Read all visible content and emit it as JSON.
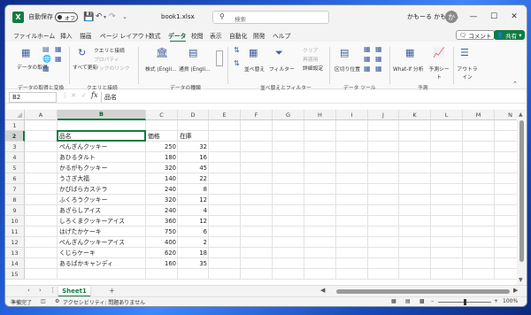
{
  "app": {
    "autosave_label": "自動保存",
    "autosave_state": "オフ",
    "filename": "book1.xlsx",
    "search_placeholder": "検索",
    "user_name": "かもーる かもかも",
    "avatar_initial": "か"
  },
  "menu": {
    "tabs": [
      "ファイル",
      "ホーム",
      "挿入",
      "描画",
      "ページ レイアウト",
      "数式",
      "データ",
      "校閲",
      "表示",
      "自動化",
      "開発",
      "ヘルプ"
    ],
    "active_tab": "データ",
    "comment_label": "コメント",
    "share_label": "共有"
  },
  "ribbon": {
    "get_data_label": "データの取得",
    "from_all_label": "すべて更新",
    "query_label": "クエリと接続",
    "property_label": "プロパティ",
    "link_label": "ブックのリンク",
    "stocks_label": "株式 (Engli…",
    "currency_label": "通貨 (Engli…",
    "sort_label": "並べ替え",
    "filter_label": "フィルター",
    "clear_label": "クリア",
    "reapply_label": "再適用",
    "advanced_label": "詳細設定",
    "text_to_cols_label": "区切り位置",
    "whatif_label": "What-If 分析",
    "forecast_label": "予測シート",
    "outline_label": "アウトライン",
    "groups": {
      "get_transform": "データの取得と変換",
      "queries": "クエリと接続",
      "data_types": "データの種類",
      "sort_filter": "並べ替えとフィルター",
      "data_tools": "データ ツール",
      "forecast": "予測"
    }
  },
  "formula_bar": {
    "name_box": "B2",
    "fx": "fx",
    "content": "品名"
  },
  "sheet": {
    "columns": [
      "A",
      "B",
      "C",
      "D",
      "E",
      "F",
      "G",
      "H",
      "I",
      "J",
      "K",
      "L",
      "M",
      "N"
    ],
    "rows": [
      "1",
      "2",
      "3",
      "4",
      "5",
      "6",
      "7",
      "8",
      "9",
      "10",
      "11",
      "12",
      "13",
      "14",
      "15"
    ],
    "headers": [
      "品名",
      "価格",
      "在庫"
    ],
    "data": [
      [
        "ぺんぎんクッキー",
        "250",
        "32"
      ],
      [
        "あひるタルト",
        "180",
        "16"
      ],
      [
        "かるがもクッキー",
        "320",
        "45"
      ],
      [
        "うさぎ大福",
        "140",
        "22"
      ],
      [
        "かぴばらカステラ",
        "240",
        "8"
      ],
      [
        "ふくろうクッキー",
        "320",
        "12"
      ],
      [
        "あざらしアイス",
        "240",
        "4"
      ],
      [
        "しろくまクッキーアイス",
        "360",
        "12"
      ],
      [
        "はげたかケーキ",
        "750",
        "6"
      ],
      [
        "ぺんぎんクッキーアイス",
        "400",
        "2"
      ],
      [
        "くじらケーキ",
        "620",
        "18"
      ],
      [
        "あるぱかキャンディ",
        "160",
        "35"
      ]
    ]
  },
  "sheet_tabs": {
    "active": "Sheet1",
    "add": "+"
  },
  "status": {
    "ready": "準備完了",
    "accessibility": "アクセシビリティ: 問題ありません",
    "zoom": "100%"
  }
}
